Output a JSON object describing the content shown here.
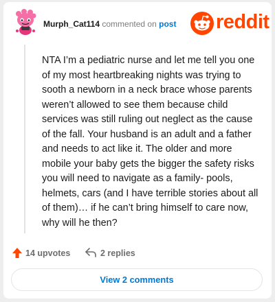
{
  "comment": {
    "username": "Murph_Cat114",
    "commented_on_text": "commented on",
    "post_link_text": "post",
    "body": "NTA I’m a pediatric nurse and let me tell you one of my most heartbreaking nights was trying to sooth a newborn in a neck brace whose parents weren’t allowed to see them because child services was still ruling out neglect as the cause of the fall. Your husband is an adult and a father and needs to act like it. The older and more mobile your baby gets the bigger the safety risks you will need to navigate as a family- pools, helmets, cars (and I have terrible stories about all of them)… if he can’t bring himself to care now, why will he then?",
    "upvotes_label": "14 upvotes",
    "replies_label": "2 replies",
    "view_comments_label": "View 2 comments"
  },
  "branding": {
    "logo_text": "reddit",
    "accent_color": "#ff4500",
    "link_color": "#0079d3"
  },
  "icons": {
    "avatar": "pink-snoo-avatar",
    "logo": "reddit-snoo-icon",
    "upvote": "upvote-arrow-icon",
    "reply": "reply-arrow-icon"
  }
}
